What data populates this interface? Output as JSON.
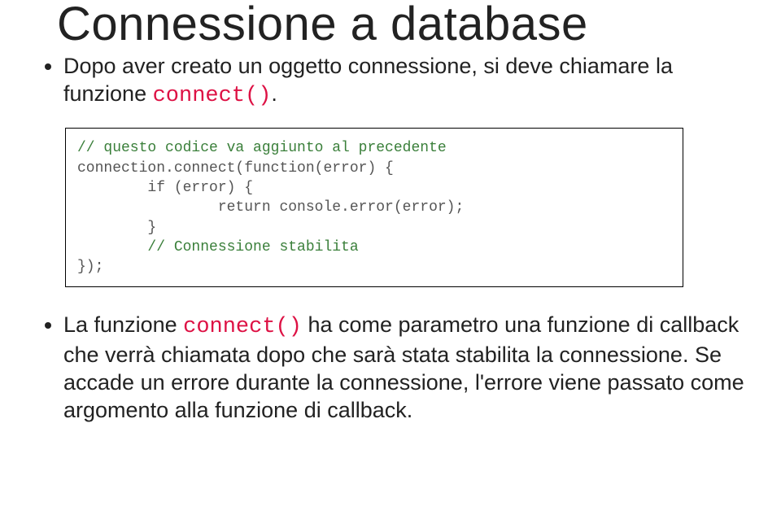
{
  "title": "Connessione a database",
  "intro": {
    "before_code": "Dopo aver creato un oggetto connessione, si deve chiamare la funzione ",
    "code": "connect()",
    "after_code": "."
  },
  "code": {
    "l1": "// questo codice va aggiunto al precedente",
    "l2": "connection.connect(function(error) {",
    "l3": "        if (error) {",
    "l4": "                return console.error(error);",
    "l5": "        }",
    "l6": "        // Connessione stabilita",
    "l7": "});"
  },
  "outro": {
    "p1_before": "La funzione ",
    "p1_code": "connect()",
    "p1_after": " ha come parametro una funzione di callback che verrà chiamata dopo che sarà stata stabilita la connessione. Se accade un errore durante la connessione, l'errore viene passato come argomento alla funzione di callback."
  }
}
